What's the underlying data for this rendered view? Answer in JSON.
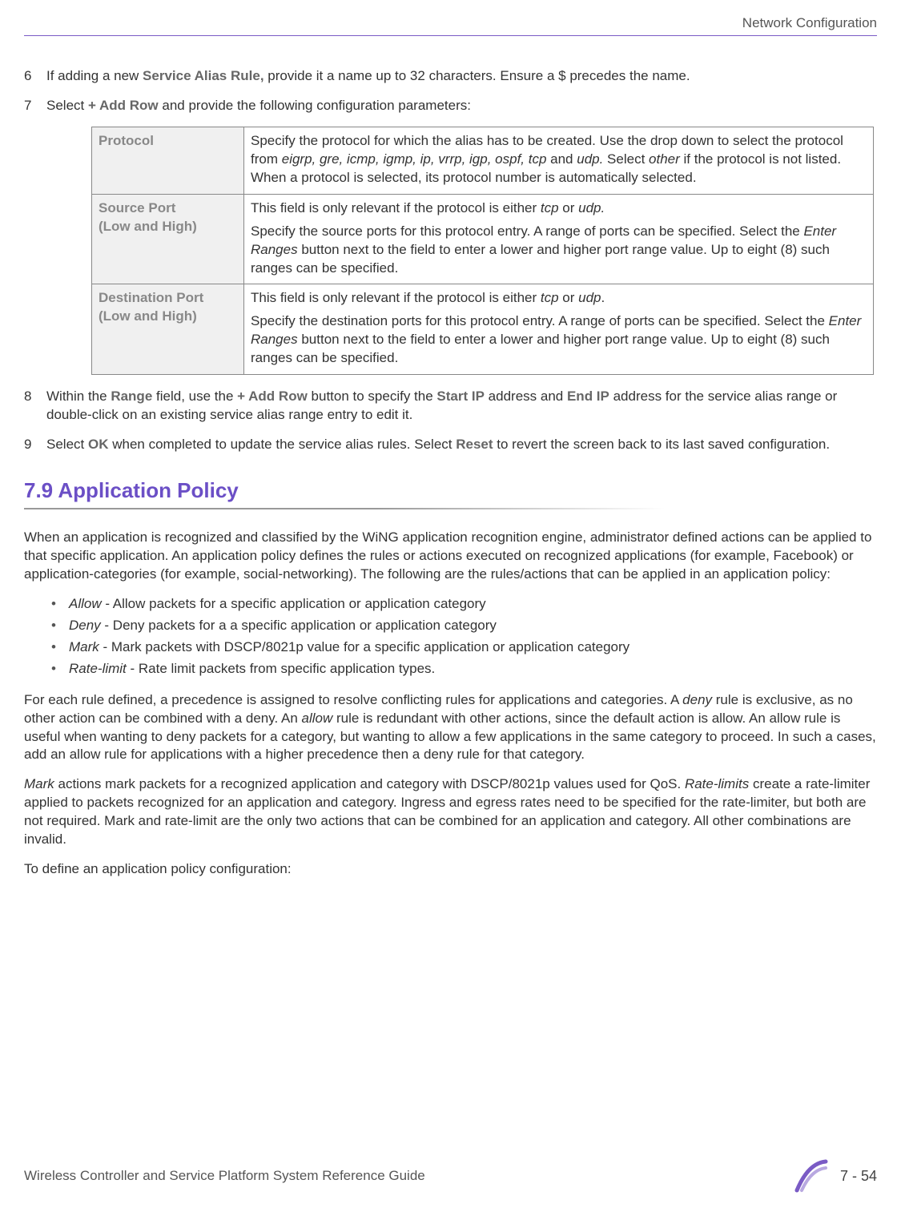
{
  "header": {
    "right": "Network Configuration"
  },
  "steps": {
    "s6": {
      "num": "6",
      "pre": "If adding a new ",
      "bold": "Service Alias Rule,",
      "post": " provide it a name up to 32 characters. Ensure a $ precedes the name."
    },
    "s7": {
      "num": "7",
      "pre": "Select ",
      "bold": "+ Add Row",
      "post": " and provide the following configuration parameters:"
    },
    "s8": {
      "num": "8",
      "p1": "Within the ",
      "b1": "Range",
      "p2": " field, use the ",
      "b2": "+ Add Row",
      "p3": " button to specify the ",
      "b3": "Start IP",
      "p4": " address and ",
      "b4": "End IP",
      "p5": " address for the service alias range or double-click on an existing service alias range entry to edit it."
    },
    "s9": {
      "num": "9",
      "p1": "Select ",
      "b1": "OK",
      "p2": " when completed to update the service alias rules. Select ",
      "b2": "Reset",
      "p3": " to revert the screen back to its last saved configuration."
    }
  },
  "table": {
    "r1": {
      "label": "Protocol",
      "d1a": "Specify the protocol for which the alias has to be created. Use the drop down to select the protocol from ",
      "d1i": "eigrp, gre, icmp, igmp, ip, vrrp, igp, ospf, tcp",
      "d1b": " and ",
      "d1i2": "udp.",
      "d1c": " Select ",
      "d1i3": "other",
      "d1d": " if the protocol is not listed. When a protocol is selected, its protocol number is automatically selected."
    },
    "r2": {
      "label1": "Source Port",
      "label2": "(Low and High)",
      "d1a": "This field is only relevant if the protocol is either ",
      "d1i1": "tcp",
      "d1b": " or ",
      "d1i2": "udp.",
      "d2a": "Specify the source ports for this protocol entry. A range of ports can be specified. Select the ",
      "d2i": "Enter Ranges",
      "d2b": " button next to the field to enter a lower and higher port range value. Up to eight (8) such ranges can be specified."
    },
    "r3": {
      "label1": "Destination Port",
      "label2": "(Low and High)",
      "d1a": "This field is only relevant if the protocol is either ",
      "d1i1": "tcp",
      "d1b": " or ",
      "d1i2": "udp",
      "d1c": ".",
      "d2a": "Specify the destination ports for this protocol entry. A range of ports can be specified. Select the ",
      "d2i": "Enter Ranges",
      "d2b": " button next to the field to enter a lower and higher port range value. Up to eight (8) such ranges can be specified."
    }
  },
  "section": {
    "title": "7.9 Application Policy"
  },
  "body": {
    "p1": "When an application is recognized and classified by the WiNG application recognition engine, administrator defined actions can be applied to that specific application. An application policy defines the rules or actions executed on recognized applications (for example, Facebook) or application-categories (for example, social-networking). The following are the rules/actions that can be applied in an application policy:",
    "b1i": "Allow",
    "b1t": " - Allow packets for a specific application or application category",
    "b2i": "Deny",
    "b2t": " - Deny packets for a a specific application or application category",
    "b3i": "Mark",
    "b3t": " - Mark packets with DSCP/8021p value for a specific application or application category",
    "b4i": "Rate-limit",
    "b4t": " - Rate limit packets from specific application types.",
    "p2a": "For each rule defined, a precedence is assigned to resolve conflicting rules for applications and categories. A ",
    "p2i1": "deny",
    "p2b": " rule is exclusive, as no other action can be combined with a deny. An ",
    "p2i2": "allow",
    "p2c": " rule is redundant with other actions, since the default action is allow. An allow rule is useful when wanting to deny packets for a category, but wanting to allow a few applications in the same category to proceed. In such a cases, add an allow rule for applications with a higher precedence then a deny rule for that category.",
    "p3i1": "Mark",
    "p3a": " actions mark packets for a recognized application and category with DSCP/8021p values used for QoS. ",
    "p3i2": "Rate-limits",
    "p3b": " create a rate-limiter applied to packets recognized for an application and category. Ingress and egress rates need to be specified for the rate-limiter, but both are not required. Mark and rate-limit are the only two actions that can be combined for an application and category. All other combinations are invalid.",
    "p4": "To define an application policy configuration:"
  },
  "footer": {
    "left": "Wireless Controller and Service Platform System Reference Guide",
    "right": "7 - 54"
  }
}
